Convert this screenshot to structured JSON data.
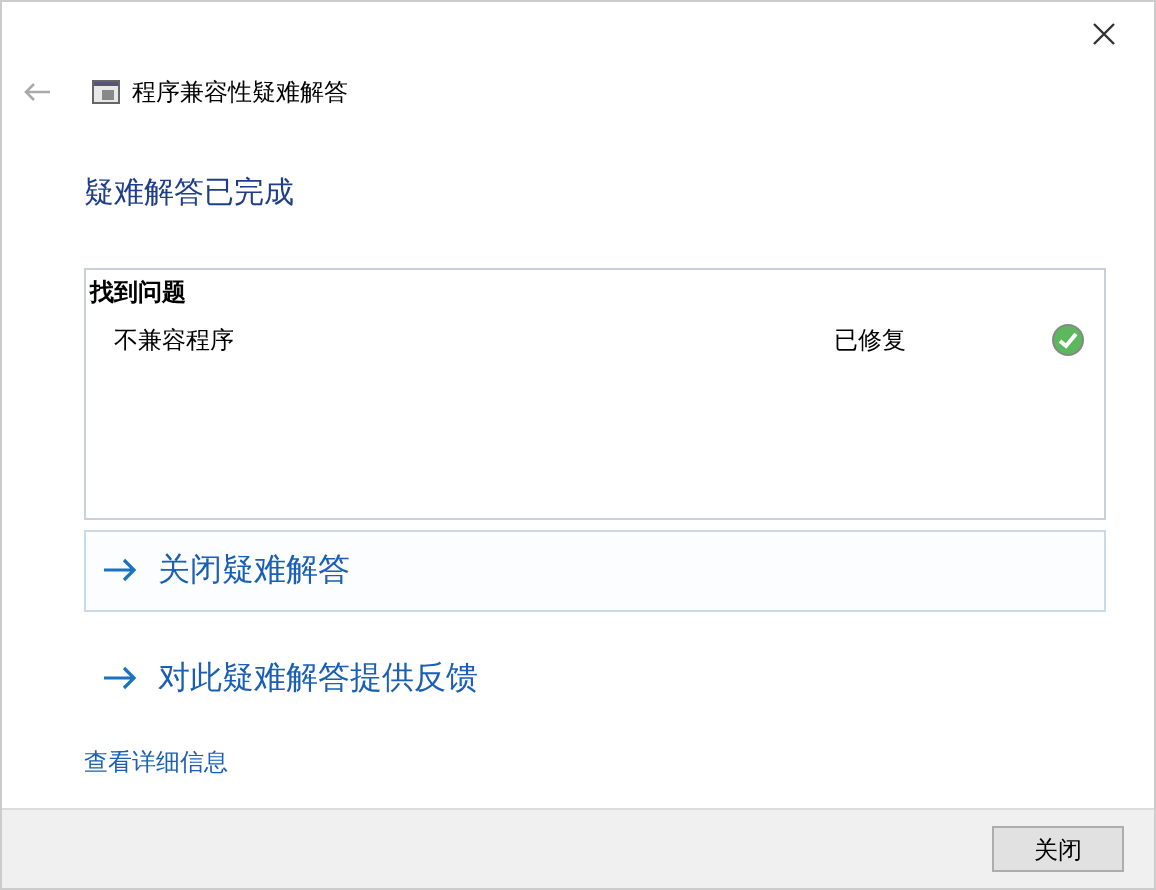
{
  "window": {
    "title": "程序兼容性疑难解答"
  },
  "heading": "疑难解答已完成",
  "problems": {
    "title": "找到问题",
    "rows": [
      {
        "name": "不兼容程序",
        "status": "已修复",
        "fixed": true
      }
    ]
  },
  "links": [
    {
      "label": "关闭疑难解答",
      "selected": true
    },
    {
      "label": "对此疑难解答提供反馈",
      "selected": false
    }
  ],
  "details_link": "查看详细信息",
  "buttons": [
    "关闭"
  ]
}
